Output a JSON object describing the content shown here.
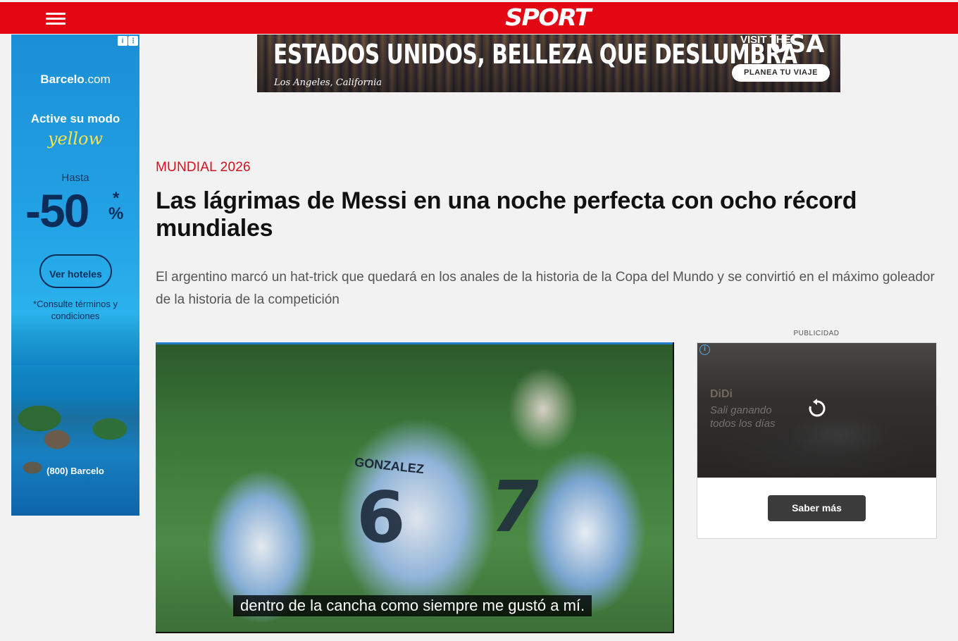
{
  "header": {
    "logo": "SPORT",
    "menu_icon": "hamburger-menu-icon",
    "background_color": "#e30613"
  },
  "left_ad": {
    "corner_info": "i",
    "corner_more": "⋮",
    "brand": "Barcelo",
    "brand_suffix": ".com",
    "line1": "Active su modo",
    "line2": "yellow",
    "hasta": "Hasta",
    "discount": "-50",
    "asterisk": "*",
    "percent": "%",
    "button": "Ver hoteles",
    "terms": "*Consulte términos y condiciones",
    "phone": "(800) Barcelo"
  },
  "top_ad": {
    "title": "ESTADOS UNIDOS, BELLEZA QUE DESLUMBRA",
    "location": "Los Angeles, California",
    "visit": "VISIT THE",
    "usa": "USA",
    "button": "PLANEA TU VIAJE"
  },
  "article": {
    "category": "MUNDIAL 2026",
    "headline": "Las lágrimas de Messi en una noche perfecta con ocho récord mundiales",
    "summary": "El argentino marcó un hat-trick que quedará en los anales de la historia de la Copa del Mundo y se convirtió en el máximo goleador de la historia de la competición",
    "category_color": "#d4101f"
  },
  "video": {
    "jersey_name": "GONZALEZ",
    "jersey_number_a": "6",
    "jersey_number_b": "7",
    "subtitle": "dentro de la cancha como siempre me gustó a mí."
  },
  "side_ad": {
    "label": "PUBLICIDAD",
    "info": "i",
    "brand": "DiDi",
    "tagline": "Sali ganando todos los días",
    "button": "Saber más"
  }
}
